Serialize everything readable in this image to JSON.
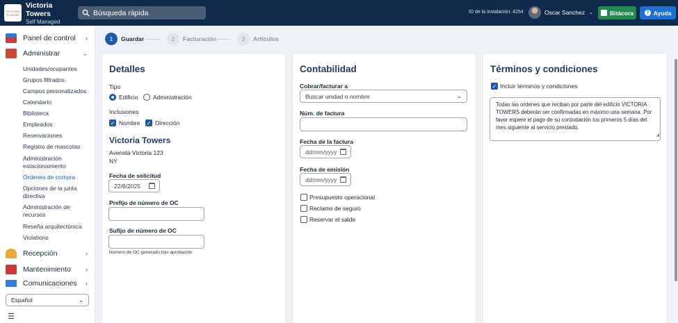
{
  "header": {
    "logo_text": "VICTORIA TOWERS",
    "app_title": "Victoria Towers",
    "app_subtitle": "Self Managed",
    "search_placeholder": "Búsqueda rápida",
    "install_id": "ID de la instalación: 4254",
    "user_name": "Oscar Sanchez",
    "logbook_button": "Bitácora",
    "help_button": "Ayuda"
  },
  "sidebar": {
    "panel": "Panel de control",
    "admin": "Administrar",
    "admin_items": [
      "Unidades/ocupantes",
      "Grupos filtrados",
      "Campos personalizados",
      "Calendario",
      "Biblioteca",
      "Empleados",
      "Reservaciones",
      "Registro de mascotas",
      "Administración estacionamiento",
      "Órdenes de compra",
      "Opciones de la junta directiva",
      "Administración de recursos",
      "Reseña arquitectónica",
      "Violations"
    ],
    "reception": "Recepción",
    "maintenance": "Mantenimiento",
    "communications": "Comunicaciones",
    "language": "Español"
  },
  "steps": [
    {
      "num": "1",
      "label": "Guardar"
    },
    {
      "num": "2",
      "label": "Facturación"
    },
    {
      "num": "3",
      "label": "Artículos"
    }
  ],
  "details": {
    "title": "Detalles",
    "type_label": "Tipo",
    "type_options": [
      "Edificio",
      "Administración"
    ],
    "inclusions_label": "Inclusiones",
    "inclusions": [
      "Nombre",
      "Dirección"
    ],
    "building_name": "Victoria Towers",
    "address_line1": "Avenida Victoria 123",
    "address_line2": "NY",
    "request_date_label": "Fecha de solicitud",
    "request_date_value": "22/8/2025",
    "prefix_label": "Prefijo de número de OC",
    "prefix_value": "",
    "suffix_label": "Sufijo de número de OC",
    "suffix_value": "",
    "suffix_help": "Número de OC generado tras aprobación"
  },
  "accounting": {
    "title": "Contabilidad",
    "bill_to_label": "Cobrar/facturar a",
    "bill_to_value": "Buscar unidad o nombre",
    "invoice_num_label": "Núm. de factura",
    "invoice_num_value": "",
    "invoice_date_label": "Fecha de la factura",
    "invoice_date_placeholder": "dd/mm/yyyy",
    "issue_date_label": "Fecha de emisión",
    "issue_date_placeholder": "dd/mm/yyyy",
    "checkboxes": [
      "Presupuesto operacional",
      "Reclamo de seguro",
      "Reservar el saldo"
    ]
  },
  "terms": {
    "title": "Términos y condiciones",
    "include_label": "Incluir términos y condiciones",
    "text": "Todas las ordenes que reciban por parte del edificio VICTORIA TOWERS deberán ser confirmadas en máximo una semana. Por favor espere el pago de su contratación los primeros 5 días del mes siguiente al servicio prestado."
  }
}
